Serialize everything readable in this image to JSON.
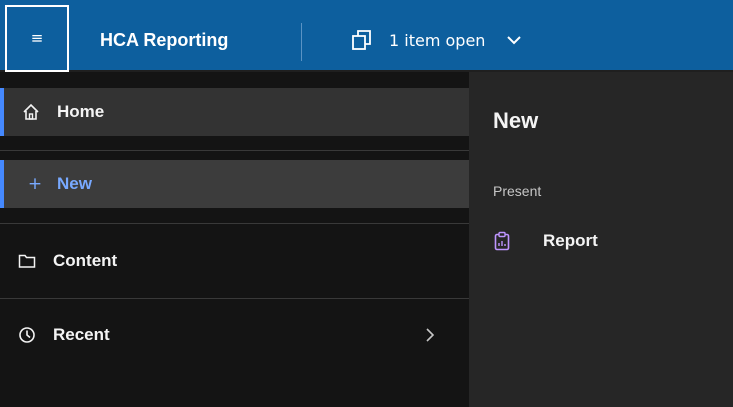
{
  "header": {
    "menu_icon": "hamburger-menu-icon",
    "app_title": "HCA Reporting",
    "open_items_icon": "stacked-windows-icon",
    "open_items_label": "1 item open",
    "open_items_chevron": "chevron-down-icon",
    "accent_color": "#0d5f9e"
  },
  "sidebar": {
    "items": [
      {
        "label": "Home",
        "icon": "home-icon"
      },
      {
        "label": "New",
        "icon": "plus-icon",
        "glyph": "+",
        "selected": true,
        "selected_color": "#78a9ff"
      },
      {
        "label": "Content",
        "icon": "folder-icon"
      },
      {
        "label": "Recent",
        "icon": "clock-icon",
        "trailing_icon": "chevron-right-icon"
      }
    ],
    "active_indicator_color": "#4589ff"
  },
  "panel": {
    "title": "New",
    "section_label": "Present",
    "items": [
      {
        "label": "Report",
        "icon": "report-clipboard-icon",
        "icon_color": "#be95ff"
      }
    ]
  }
}
